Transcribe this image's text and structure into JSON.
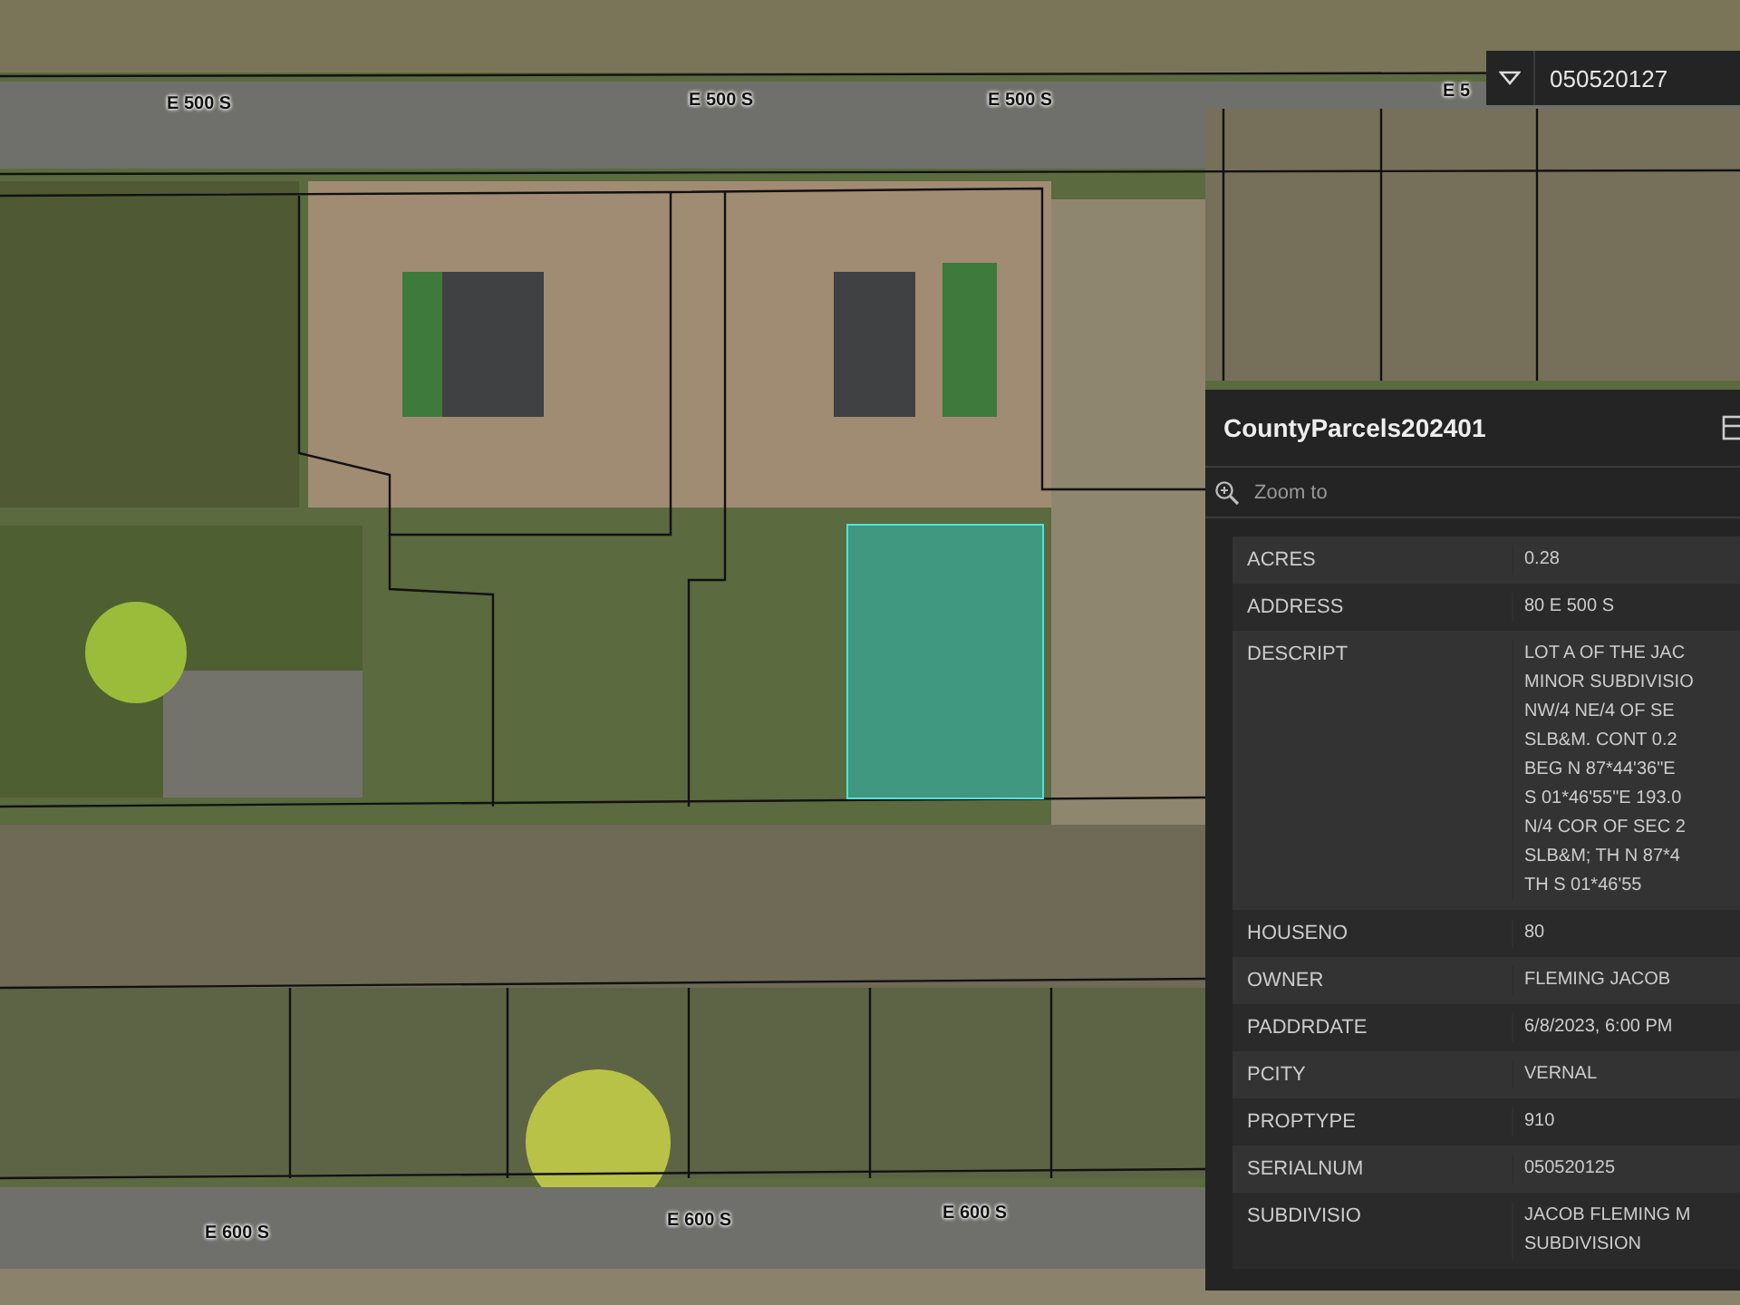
{
  "map": {
    "street_labels": [
      {
        "text": "E 500 S"
      },
      {
        "text": "E 500 S"
      },
      {
        "text": "E 500 S"
      },
      {
        "text": "E 5"
      },
      {
        "text": "E 600 S"
      },
      {
        "text": "E 600 S"
      },
      {
        "text": "E 600 S"
      }
    ]
  },
  "search": {
    "value": "050520127"
  },
  "popup": {
    "title": "CountyParcels202401",
    "zoom_action": "Zoom to",
    "fields": [
      {
        "name": "ACRES",
        "lines": [
          "0.28"
        ]
      },
      {
        "name": "ADDRESS",
        "lines": [
          "80 E 500 S"
        ]
      },
      {
        "name": "DESCRIPT",
        "lines": [
          "LOT A OF THE JAC",
          "MINOR SUBDIVISIO",
          "NW/4 NE/4 OF SE",
          "SLB&M. CONT 0.2",
          "BEG N 87*44'36\"E",
          "S 01*46'55\"E 193.0",
          "N/4 COR OF SEC 2",
          "SLB&M; TH N 87*4",
          "TH S 01*46'55"
        ]
      },
      {
        "name": "HOUSENO",
        "lines": [
          "80"
        ]
      },
      {
        "name": "OWNER",
        "lines": [
          "FLEMING JACOB"
        ]
      },
      {
        "name": "PADDRDATE",
        "lines": [
          "6/8/2023, 6:00 PM"
        ]
      },
      {
        "name": "PCITY",
        "lines": [
          "VERNAL"
        ]
      },
      {
        "name": "PROPTYPE",
        "lines": [
          "910"
        ]
      },
      {
        "name": "SERIALNUM",
        "lines": [
          "050520125"
        ]
      },
      {
        "name": "SUBDIVISIO",
        "lines": [
          "JACOB FLEMING M",
          "SUBDIVISION"
        ]
      }
    ]
  }
}
